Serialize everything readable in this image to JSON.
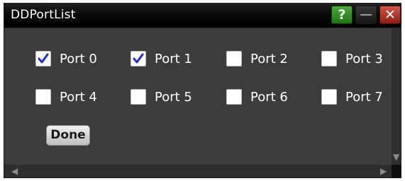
{
  "window": {
    "title": "DDPortList",
    "help_glyph": "?",
    "close_glyph": "✕"
  },
  "ports": [
    {
      "label": "Port 0",
      "checked": true
    },
    {
      "label": "Port 1",
      "checked": true
    },
    {
      "label": "Port 2",
      "checked": false
    },
    {
      "label": "Port 3",
      "checked": false
    },
    {
      "label": "Port 4",
      "checked": false
    },
    {
      "label": "Port 5",
      "checked": false
    },
    {
      "label": "Port 6",
      "checked": false
    },
    {
      "label": "Port 7",
      "checked": false
    }
  ],
  "done_label": "Done",
  "icons": {
    "help": "question-mark",
    "minimize": "minimize-bar",
    "close": "x-mark",
    "check": "checkmark",
    "scroll_left": "◀",
    "scroll_right": "▶",
    "scroll_down": "▼"
  },
  "colors": {
    "check": "#1a2fd6",
    "help_button": "#2f8f22",
    "close_button": "#b8362b",
    "background": "#3c3c3c"
  }
}
